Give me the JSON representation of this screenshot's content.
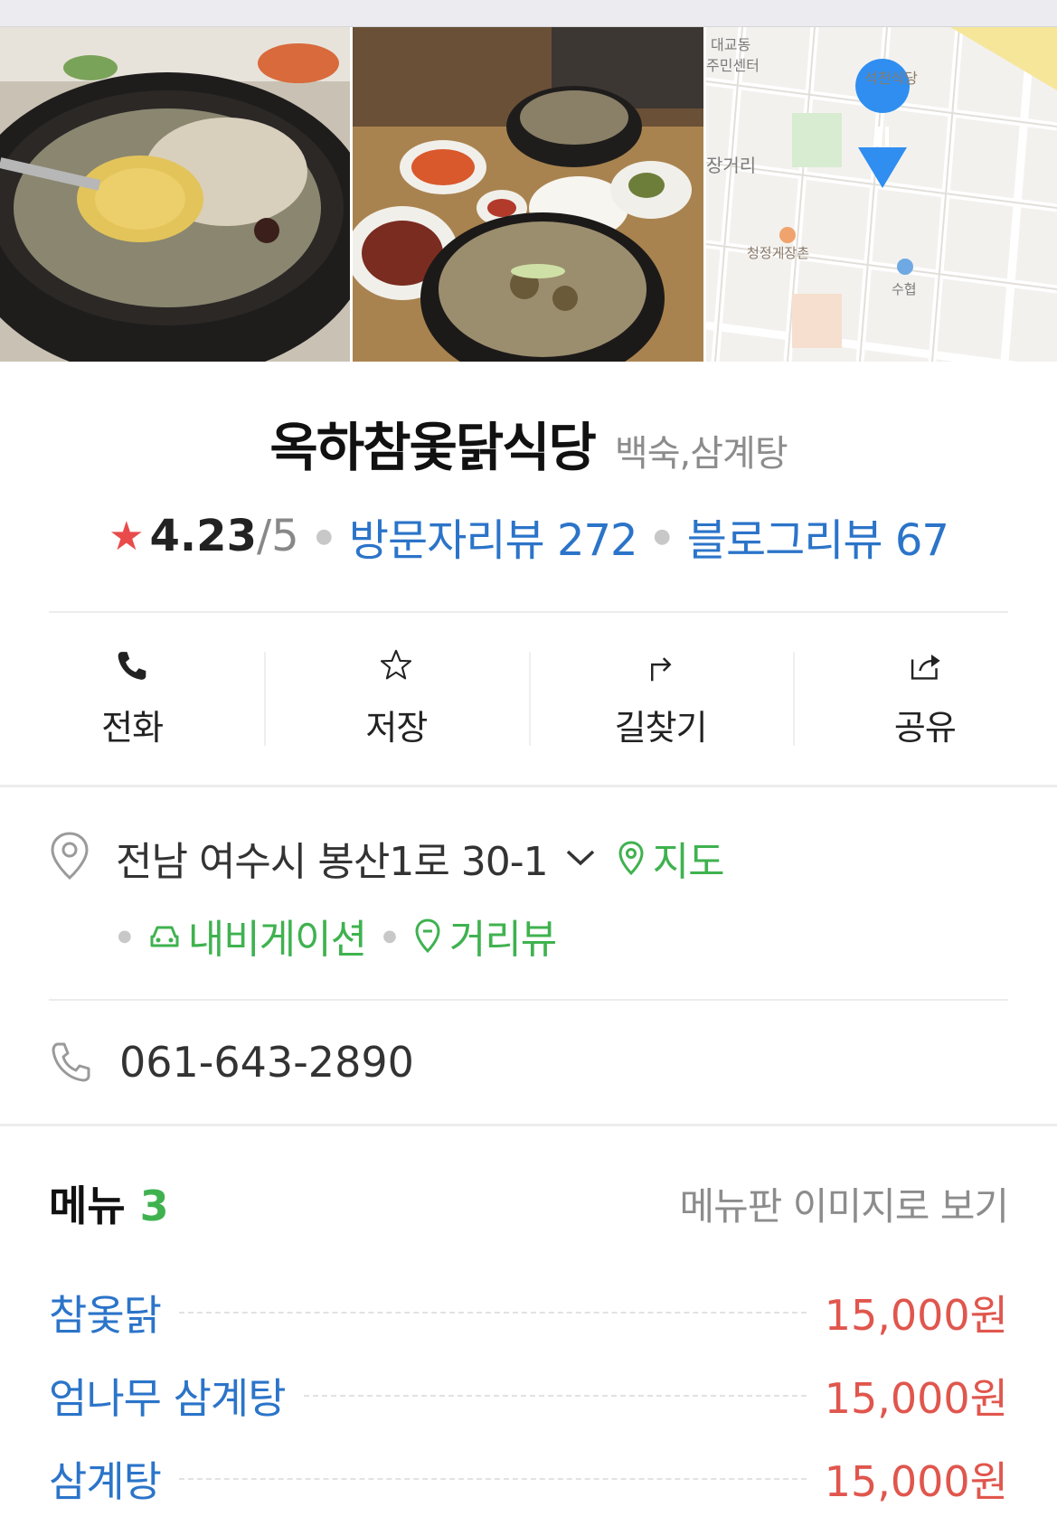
{
  "photos": {
    "map_labels": [
      "대교동",
      "주민센터",
      "석천식당",
      "장거리",
      "청정게장촌",
      "수협"
    ]
  },
  "place": {
    "name": "옥하참옻닭식당",
    "category": "백숙,삼계탕",
    "rating": "4.23",
    "rating_max": "/5",
    "visitor_reviews": "방문자리뷰 272",
    "blog_reviews": "블로그리뷰 67"
  },
  "actions": [
    {
      "label": "전화",
      "icon": "phone-icon"
    },
    {
      "label": "저장",
      "icon": "star-icon"
    },
    {
      "label": "길찾기",
      "icon": "directions-icon"
    },
    {
      "label": "공유",
      "icon": "share-icon"
    }
  ],
  "address": {
    "text": "전남 여수시 봉산1로 30-1",
    "map_label": "지도",
    "navigation_label": "내비게이션",
    "streetview_label": "거리뷰"
  },
  "phone": "061-643-2890",
  "menu": {
    "title": "메뉴",
    "count": "3",
    "view_image": "메뉴판 이미지로 보기",
    "items": [
      {
        "name": "참옻닭",
        "price": "15,000원"
      },
      {
        "name": "엄나무 삼계탕",
        "price": "15,000원"
      },
      {
        "name": "삼계탕",
        "price": "15,000원"
      }
    ]
  },
  "colors": {
    "link_blue": "#2b74c9",
    "green": "#3fb24f",
    "price_red": "#e0564d",
    "star_red": "#e94b4b"
  }
}
